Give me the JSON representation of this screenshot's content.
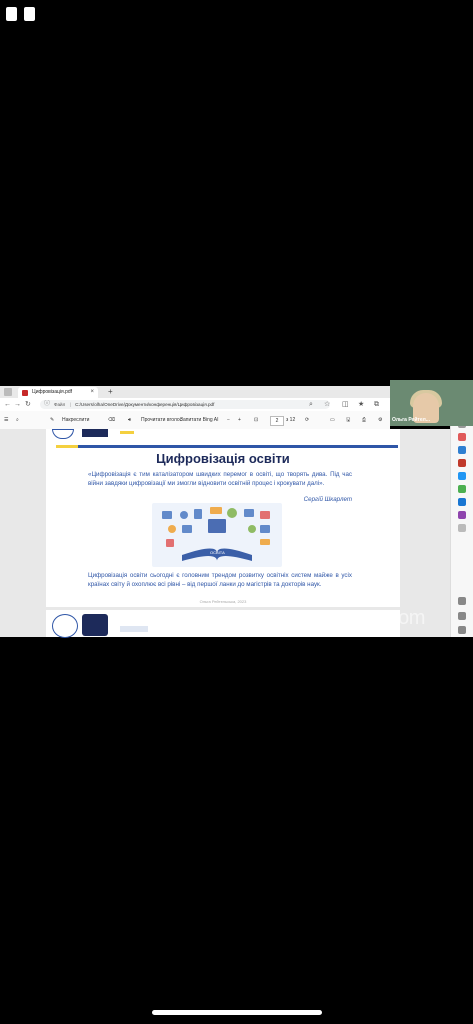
{
  "browser": {
    "tab_title": "Цифровізація.pdf",
    "new_tab_glyph": "+",
    "url_label": "Файл",
    "url_path": "C:/Users/olha/OneDrive/Документи/конференція/Цифровізація.pdf"
  },
  "pdf_toolbar": {
    "draw_label": "Накреслити",
    "read_aloud_label": "Прочитати вголос",
    "ask_bing_label": "Запитати Bing AI",
    "page_current": "2",
    "page_total": "з 12"
  },
  "slide": {
    "title": "Цифровізація освіти",
    "quote": "«Цифровізація є тим каталізатором швидких перемог в освіті, що творять дива. Під час війни завдяки цифровізації ми змогли відновити освітній процес і крокувати далі».",
    "author": "Сергій Шкарлет",
    "illustration_label": "ОСВІТА",
    "body": "Цифровізація освіти сьогодні є головним трендом розвитку освітніх систем майже в усіх країнах світу й охоплює всі рівні – від першої ланки до магістрів та докторів наук.",
    "footer": "Ольга Рейтельська, 2023"
  },
  "zoom": {
    "participant_name": "Ольга Рейтел...",
    "watermark": "zoom"
  },
  "colors": {
    "accent_blue": "#2f56a7",
    "title_navy": "#1d2a5a",
    "yellow": "#f4d03f"
  }
}
